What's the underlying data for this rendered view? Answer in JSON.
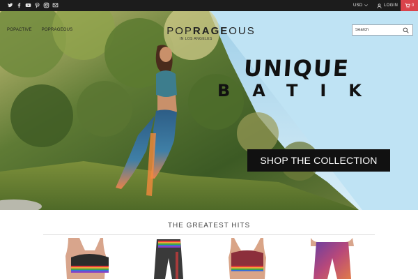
{
  "topbar": {
    "social_icons": [
      "twitter-icon",
      "facebook-icon",
      "youtube-icon",
      "pinterest-icon",
      "instagram-icon",
      "mail-icon"
    ],
    "currency": "USD",
    "login_label": "LOGIN",
    "cart_count": "0",
    "cart_color": "#d9434b"
  },
  "header": {
    "nav": [
      "POPACTIVE",
      "POPRAGEOUS"
    ],
    "logo_light": "POP",
    "logo_bold": "RAGE",
    "logo_tail": "OUS",
    "logo_tagline": "IN LOS ANGELES",
    "search_placeholder": "Search"
  },
  "hero": {
    "headline_line1": "UNIQUE",
    "headline_line2": "BATIK",
    "cta_label": "SHOP THE COLLECTION"
  },
  "section": {
    "title": "THE GREATEST HITS"
  }
}
